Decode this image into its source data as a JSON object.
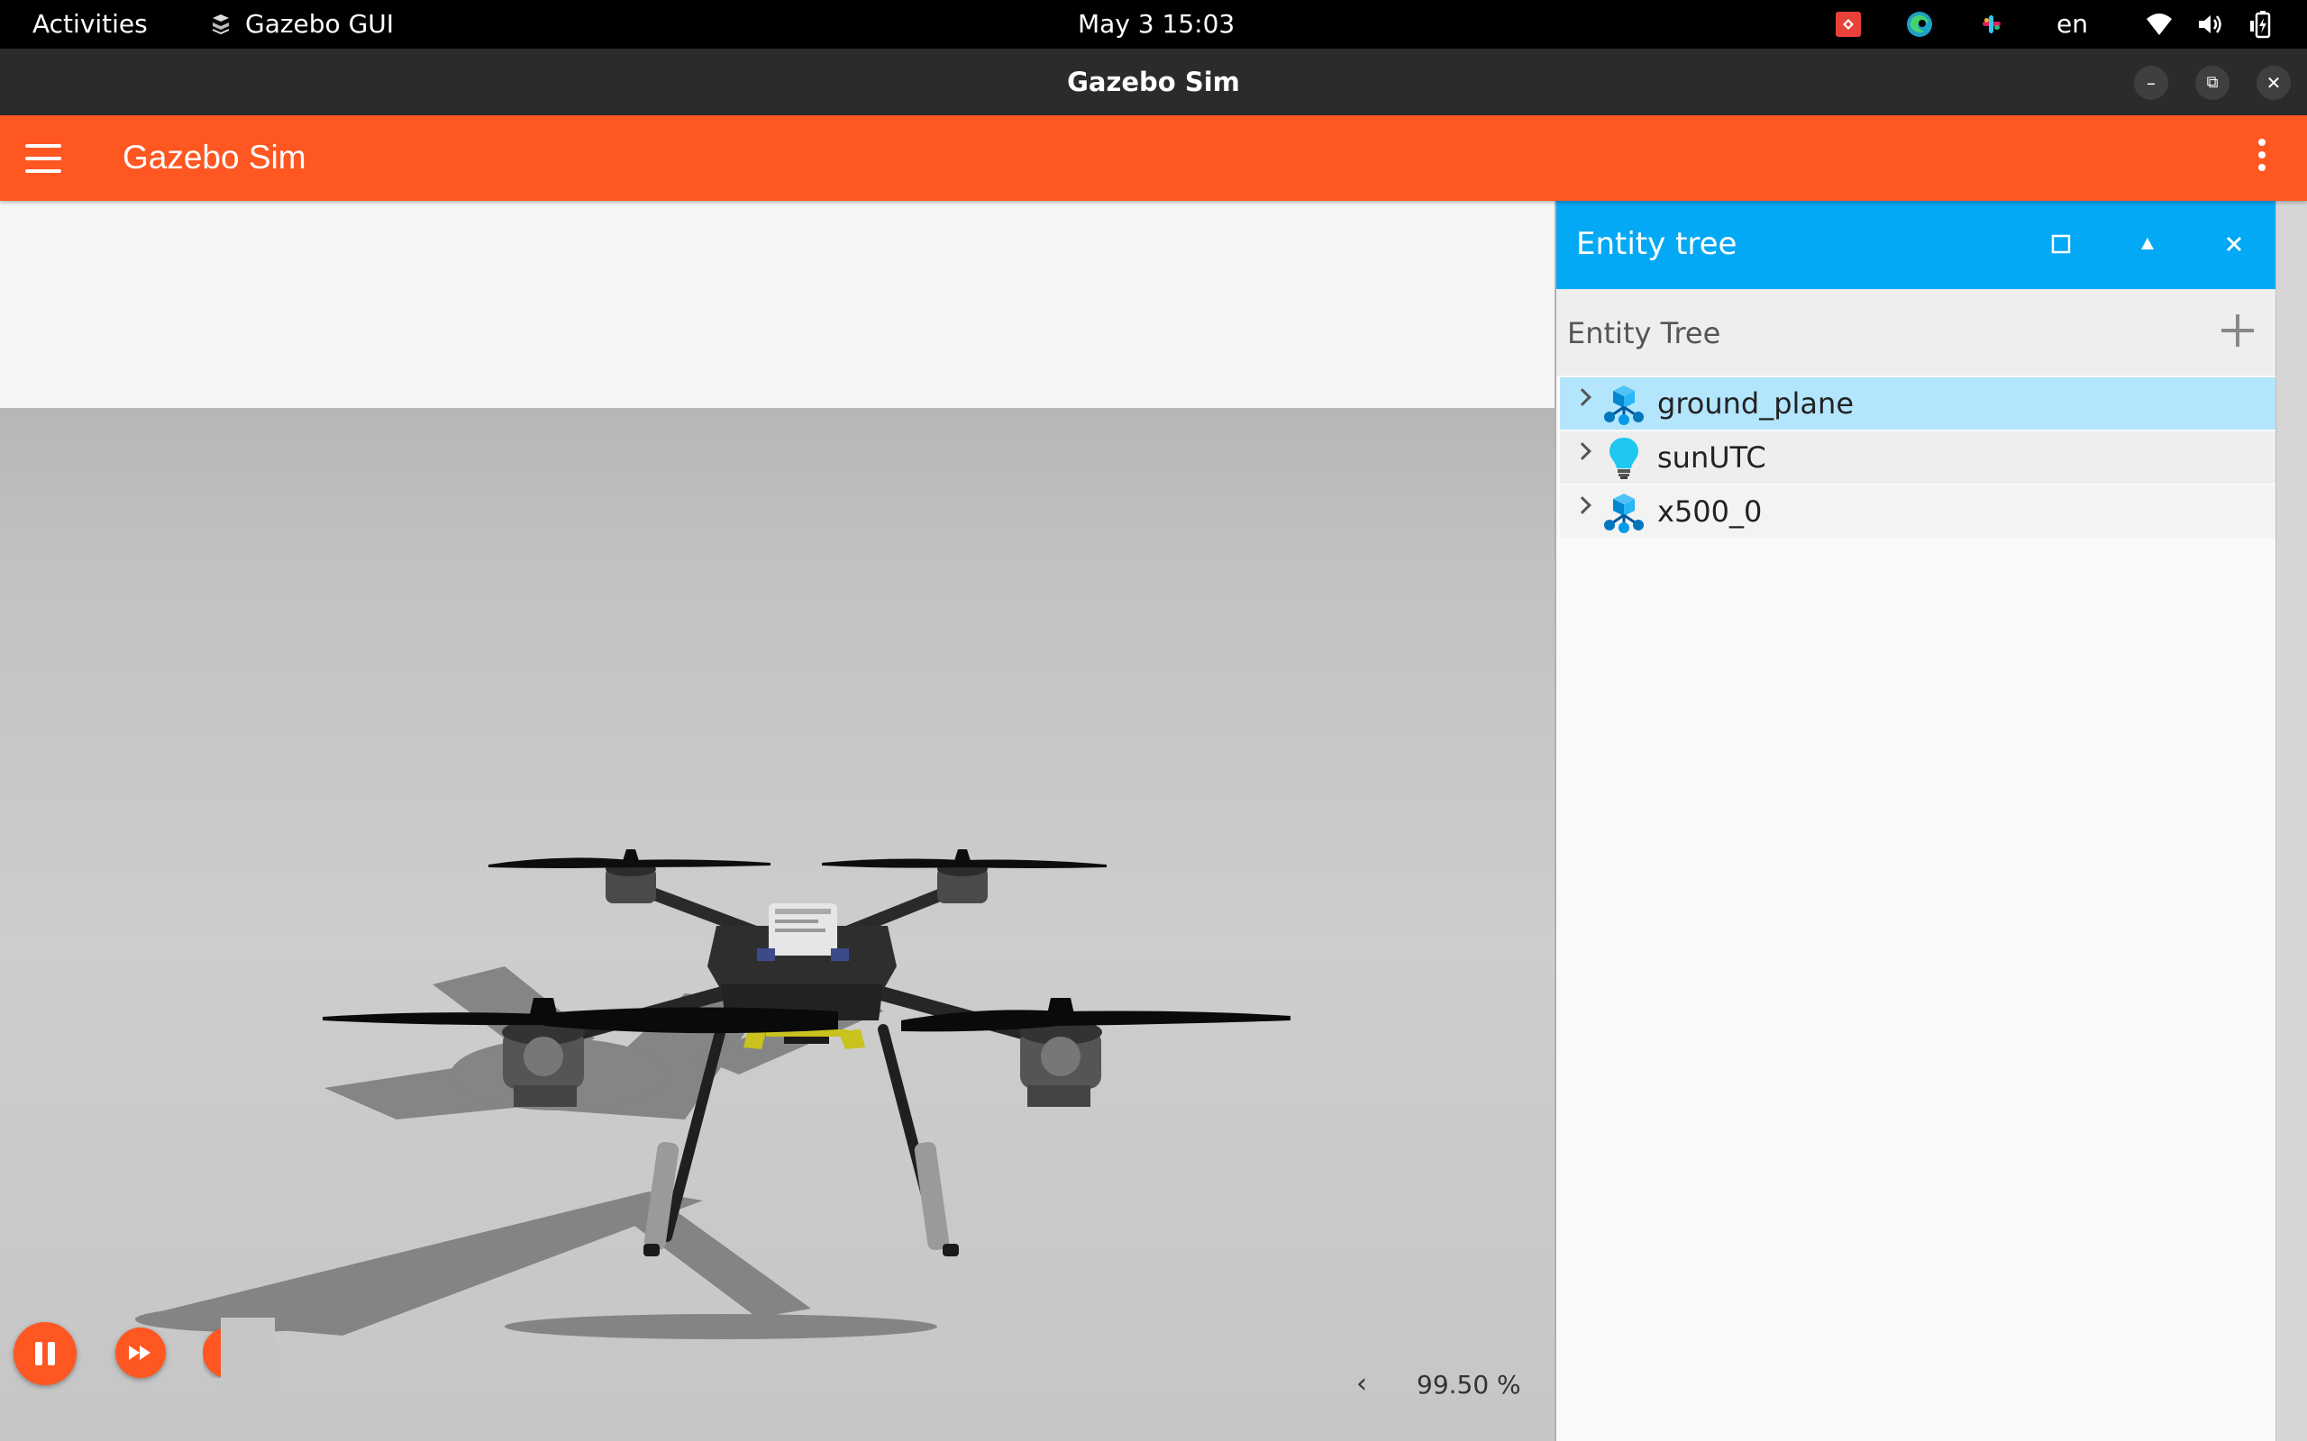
{
  "system_bar": {
    "activities": "Activities",
    "app_name": "Gazebo GUI",
    "clock": "May 3  15:03",
    "language": "en",
    "tray_icons": [
      "anydesk-icon",
      "edge-icon",
      "slack-icon",
      "wifi-icon",
      "volume-icon",
      "battery-icon"
    ]
  },
  "window": {
    "title": "Gazebo Sim",
    "minimize": "–",
    "maximize": "⧉",
    "close": "✕"
  },
  "toolbar": {
    "title": "Gazebo Sim",
    "accent": "#fe5722"
  },
  "scene": {
    "rtf_value": "99.50 %",
    "rtf_arrow": "‹"
  },
  "entity_panel": {
    "header": "Entity tree",
    "header_color": "#03a9f4",
    "subheader": "Entity Tree",
    "items": [
      {
        "label": "ground_plane",
        "icon": "model-icon",
        "selected": true
      },
      {
        "label": "sunUTC",
        "icon": "light-bulb-icon",
        "selected": false
      },
      {
        "label": "x500_0",
        "icon": "model-icon",
        "selected": false
      }
    ]
  }
}
